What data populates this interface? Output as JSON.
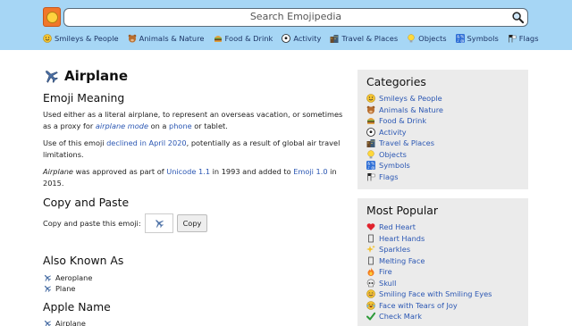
{
  "search": {
    "placeholder": "Search Emojipedia"
  },
  "nav": [
    {
      "label": "Smileys & People",
      "icon": "smiley-icon"
    },
    {
      "label": "Animals & Nature",
      "icon": "bear-icon"
    },
    {
      "label": "Food & Drink",
      "icon": "burger-icon"
    },
    {
      "label": "Activity",
      "icon": "soccer-ball-icon"
    },
    {
      "label": "Travel & Places",
      "icon": "buildings-icon"
    },
    {
      "label": "Objects",
      "icon": "lightbulb-icon"
    },
    {
      "label": "Symbols",
      "icon": "symbols-icon"
    },
    {
      "label": "Flags",
      "icon": "flags-icon"
    }
  ],
  "page": {
    "title": "Airplane",
    "meaning_heading": "Emoji Meaning",
    "meaning_p1": {
      "before": "Used either as a literal airplane, to represent an overseas vacation, or sometimes as a proxy for ",
      "link1": "airplane mode",
      "middle": " on a ",
      "link2": "phone",
      "after": " or tablet."
    },
    "meaning_p2": {
      "before": "Use of this emoji ",
      "link": "declined in April 2020",
      "after": ", potentially as a result of global air travel limitations."
    },
    "meaning_p3": {
      "name": "Airplane",
      "before": " was approved as part of ",
      "link1": "Unicode 1.1",
      "middle": " in 1993 and added to ",
      "link2": "Emoji 1.0",
      "after": " in 2015."
    },
    "copy_heading": "Copy and Paste",
    "copy_label": "Copy and paste this emoji:",
    "copy_button": "Copy",
    "aka_heading": "Also Known As",
    "aka": [
      "Aeroplane",
      "Plane"
    ],
    "apple_heading": "Apple Name",
    "apple_name": "Airplane"
  },
  "categories": {
    "heading": "Categories",
    "items": [
      {
        "label": "Smileys & People",
        "icon": "smiley-icon"
      },
      {
        "label": "Animals & Nature",
        "icon": "bear-icon"
      },
      {
        "label": "Food & Drink",
        "icon": "burger-icon"
      },
      {
        "label": "Activity",
        "icon": "soccer-ball-icon"
      },
      {
        "label": "Travel & Places",
        "icon": "buildings-icon"
      },
      {
        "label": "Objects",
        "icon": "lightbulb-icon"
      },
      {
        "label": "Symbols",
        "icon": "symbols-icon"
      },
      {
        "label": "Flags",
        "icon": "flags-icon"
      }
    ]
  },
  "popular": {
    "heading": "Most Popular",
    "items": [
      {
        "label": "Red Heart",
        "icon": "red-heart-icon"
      },
      {
        "label": "Heart Hands",
        "icon": "missing-glyph-icon"
      },
      {
        "label": "Sparkles",
        "icon": "sparkles-icon"
      },
      {
        "label": "Melting Face",
        "icon": "missing-glyph-icon"
      },
      {
        "label": "Fire",
        "icon": "fire-icon"
      },
      {
        "label": "Skull",
        "icon": "skull-icon"
      },
      {
        "label": "Smiling Face with Smiling Eyes",
        "icon": "smiling-face-icon"
      },
      {
        "label": "Face with Tears of Joy",
        "icon": "tears-of-joy-icon"
      },
      {
        "label": "Check Mark",
        "icon": "check-mark-icon"
      }
    ]
  },
  "colors": {
    "header_bg": "#a6d6f5",
    "link": "#2b57b3",
    "sidebar_bg": "#ebebeb"
  }
}
